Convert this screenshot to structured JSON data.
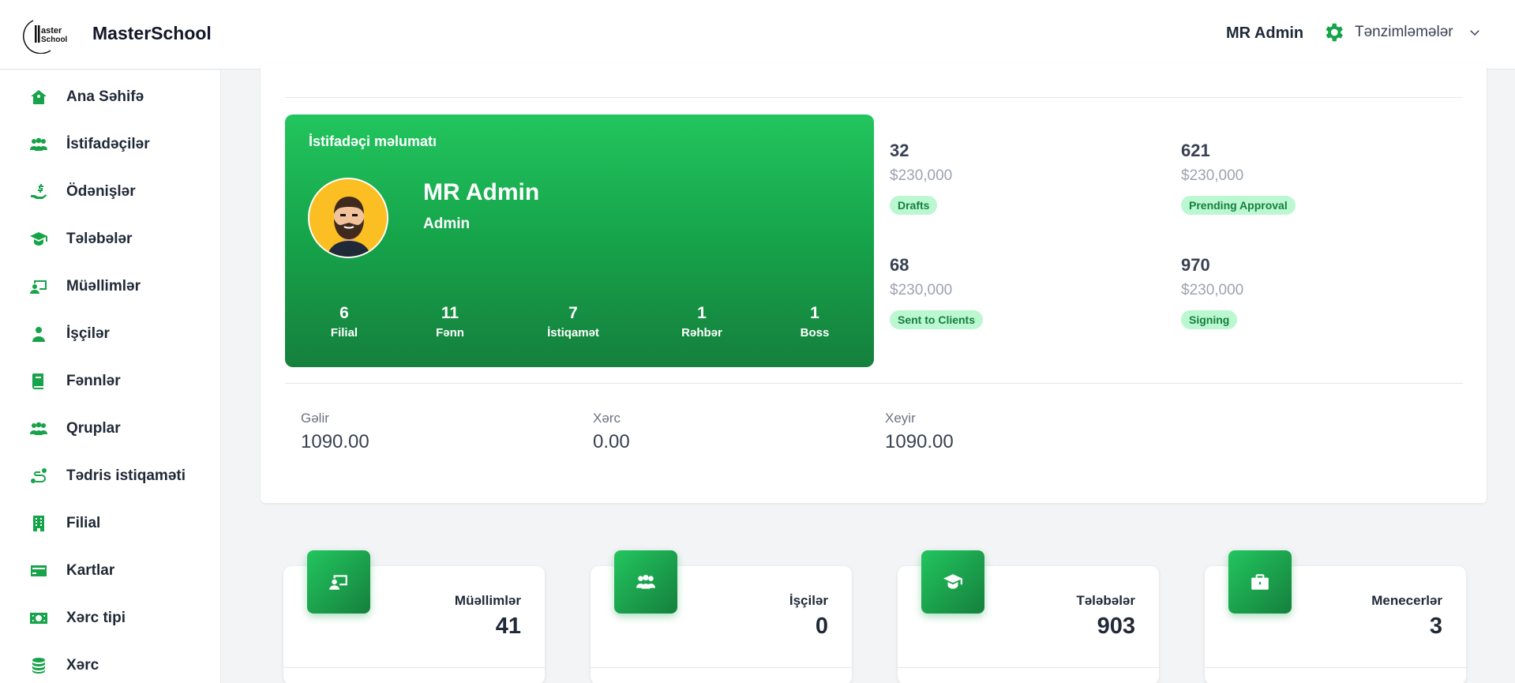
{
  "header": {
    "brand": "MasterSchool",
    "user_name": "MR Admin",
    "settings_label": "Tənzimləmələr"
  },
  "sidebar": {
    "items": [
      {
        "label": "Ana Səhifə",
        "icon": "home-icon"
      },
      {
        "label": "İstifadəçilər",
        "icon": "users-icon"
      },
      {
        "label": "Ödənişlər",
        "icon": "payment-icon"
      },
      {
        "label": "Tələbələr",
        "icon": "graduation-cap-icon"
      },
      {
        "label": "Müəllimlər",
        "icon": "teacher-icon"
      },
      {
        "label": "İşçilər",
        "icon": "worker-icon"
      },
      {
        "label": "Fənnlər",
        "icon": "book-icon"
      },
      {
        "label": "Qruplar",
        "icon": "group-icon"
      },
      {
        "label": "Tədris istiqaməti",
        "icon": "route-icon"
      },
      {
        "label": "Filial",
        "icon": "building-icon"
      },
      {
        "label": "Kartlar",
        "icon": "card-icon"
      },
      {
        "label": "Xərc tipi",
        "icon": "money-icon"
      },
      {
        "label": "Xərc",
        "icon": "coins-icon"
      }
    ]
  },
  "profile": {
    "title": "İstifadəçi məlumatı",
    "name": "MR Admin",
    "role": "Admin",
    "stats": [
      {
        "value": "6",
        "label": "Filial"
      },
      {
        "value": "11",
        "label": "Fənn"
      },
      {
        "value": "7",
        "label": "İstiqamət"
      },
      {
        "value": "1",
        "label": "Rəhbər"
      },
      {
        "value": "1",
        "label": "Boss"
      }
    ]
  },
  "mini_stats": [
    {
      "number": "32",
      "amount": "$230,000",
      "badge": "Drafts"
    },
    {
      "number": "621",
      "amount": "$230,000",
      "badge": "Prending Approval"
    },
    {
      "number": "68",
      "amount": "$230,000",
      "badge": "Sent to Clients"
    },
    {
      "number": "970",
      "amount": "$230,000",
      "badge": "Signing"
    }
  ],
  "finance": [
    {
      "label": "Gəlir",
      "value": "1090.00"
    },
    {
      "label": "Xərc",
      "value": "0.00"
    },
    {
      "label": "Xeyir",
      "value": "1090.00"
    }
  ],
  "stat_cards": [
    {
      "label": "Müəllimlər",
      "value": "41",
      "icon": "teacher-icon"
    },
    {
      "label": "İşçilər",
      "value": "0",
      "icon": "users-icon"
    },
    {
      "label": "Tələbələr",
      "value": "903",
      "icon": "graduation-cap-icon"
    },
    {
      "label": "Menecerlər",
      "value": "3",
      "icon": "briefcase-icon"
    }
  ],
  "colors": {
    "accent": "#16a34a",
    "badge_bg": "#bbf7d0",
    "badge_text": "#15803d"
  }
}
